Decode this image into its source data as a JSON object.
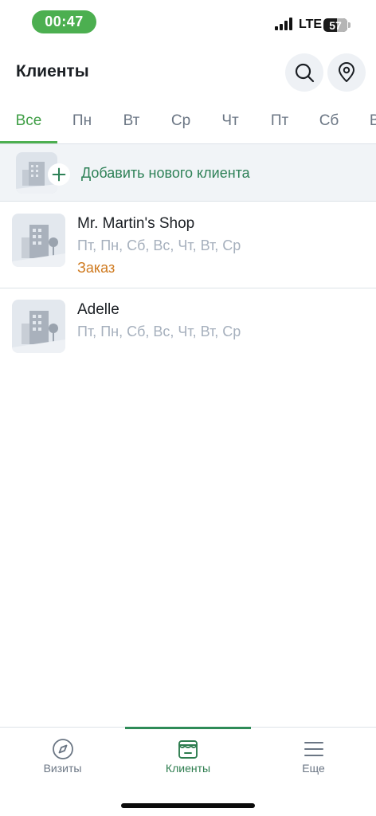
{
  "status_bar": {
    "time": "00:47",
    "network": "LTE",
    "battery": "57",
    "battery_level": 0.57
  },
  "header": {
    "title": "Клиенты",
    "search_icon": "search-icon",
    "location_icon": "map-pin-icon"
  },
  "tabs": [
    {
      "label": "Все",
      "active": true
    },
    {
      "label": "Пн"
    },
    {
      "label": "Вт"
    },
    {
      "label": "Ср"
    },
    {
      "label": "Чт"
    },
    {
      "label": "Пт"
    },
    {
      "label": "Сб"
    },
    {
      "label": "Вс"
    }
  ],
  "add_client": {
    "label": "Добавить нового клиента",
    "icon": "plus-icon"
  },
  "clients": [
    {
      "name": "Mr. Martin's Shop",
      "days": "Пт, Пн, Сб, Вс, Чт, Вт, Ср",
      "status": "Заказ"
    },
    {
      "name": "Adelle",
      "days": "Пт, Пн, Сб, Вс, Чт, Вт, Ср"
    }
  ],
  "bottom_nav": [
    {
      "label": "Визиты",
      "icon": "compass-icon"
    },
    {
      "label": "Клиенты",
      "icon": "store-icon",
      "active": true
    },
    {
      "label": "Еще",
      "icon": "menu-icon"
    }
  ],
  "colors": {
    "accent": "#4caf50",
    "primary_green": "#2e8157",
    "status_orange": "#cf7a1f",
    "muted_text": "#a6b0bd"
  }
}
